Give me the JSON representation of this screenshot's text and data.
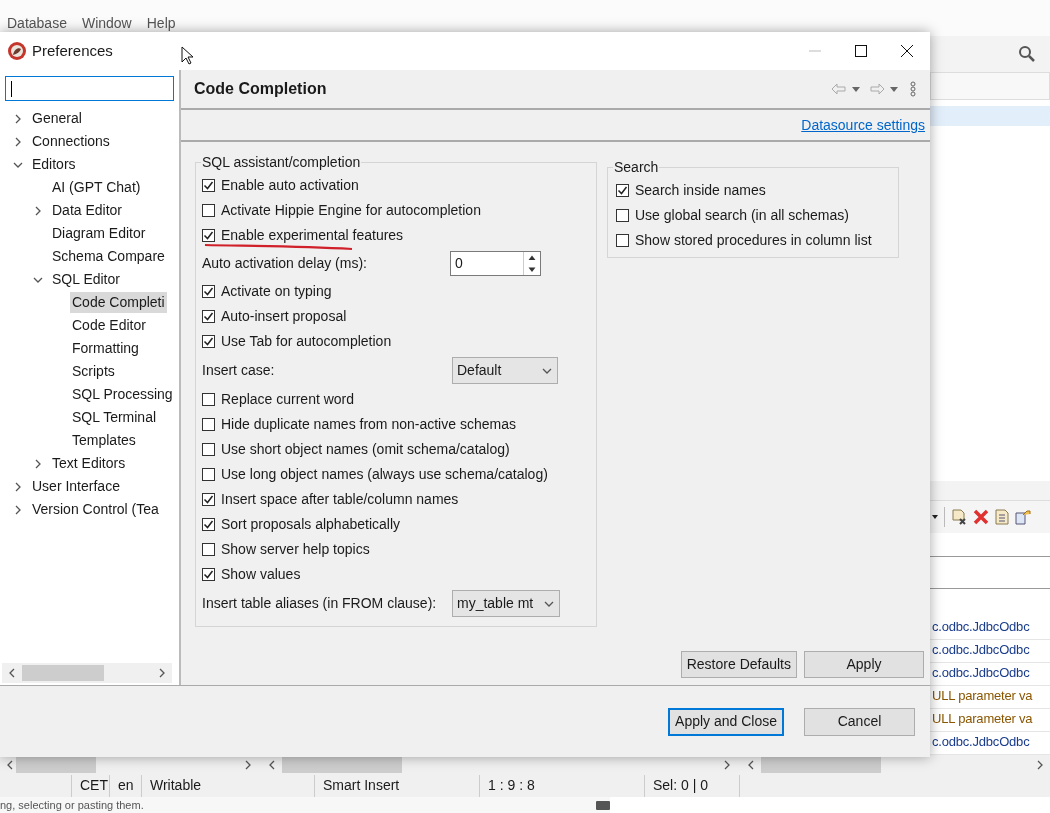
{
  "app": {
    "menu": [
      "Database",
      "Window",
      "Help"
    ],
    "log_rows": [
      {
        "text": "c.odbc.JdbcOdbc",
        "color": "#1a3c8c"
      },
      {
        "text": "c.odbc.JdbcOdbc",
        "color": "#1a3c8c"
      },
      {
        "text": "c.odbc.JdbcOdbc",
        "color": "#1a3c8c"
      },
      {
        "text": "ULL parameter va",
        "color": "#8a5600"
      },
      {
        "text": "ULL parameter va",
        "color": "#8a5600"
      },
      {
        "text": "c.odbc.JdbcOdbc",
        "color": "#1a3c8c"
      }
    ],
    "status_bar": [
      "CET",
      "en",
      "Writable",
      "Smart Insert",
      "1 : 9 : 8",
      "Sel: 0 | 0"
    ],
    "hint": "ng, selecting or pasting them."
  },
  "dialog": {
    "title": "Preferences",
    "tree": [
      {
        "label": "General",
        "kind": "folder",
        "expanded": false,
        "selected": false
      },
      {
        "label": "Connections",
        "kind": "folder",
        "expanded": false,
        "selected": false
      },
      {
        "label": "Editors",
        "kind": "folder",
        "expanded": true,
        "selected": false,
        "children": [
          {
            "label": "AI (GPT Chat)",
            "kind": "leaf",
            "selected": false
          },
          {
            "label": "Data Editor",
            "kind": "folder",
            "expanded": false,
            "selected": false
          },
          {
            "label": "Diagram Editor",
            "kind": "leaf",
            "selected": false
          },
          {
            "label": "Schema Compare",
            "kind": "leaf",
            "selected": false
          },
          {
            "label": "SQL Editor",
            "kind": "folder",
            "expanded": true,
            "selected": false,
            "children": [
              {
                "label": "Code Completi",
                "kind": "leaf",
                "selected": true
              },
              {
                "label": "Code Editor",
                "kind": "leaf",
                "selected": false
              },
              {
                "label": "Formatting",
                "kind": "leaf",
                "selected": false
              },
              {
                "label": "Scripts",
                "kind": "leaf",
                "selected": false
              },
              {
                "label": "SQL Processing",
                "kind": "leaf",
                "selected": false
              },
              {
                "label": "SQL Terminal",
                "kind": "leaf",
                "selected": false
              },
              {
                "label": "Templates",
                "kind": "leaf",
                "selected": false
              }
            ]
          },
          {
            "label": "Text Editors",
            "kind": "folder",
            "expanded": false,
            "selected": false
          }
        ]
      },
      {
        "label": "User Interface",
        "kind": "folder",
        "expanded": false,
        "selected": false
      },
      {
        "label": "Version Control (Tea",
        "kind": "folder",
        "expanded": false,
        "selected": false
      }
    ],
    "page": {
      "title": "Code Completion",
      "link": "Datasource settings",
      "main_group": {
        "title": "SQL assistant/completion",
        "rows": [
          {
            "kind": "checkbox",
            "label": "Enable auto activation",
            "checked": true,
            "marked": false
          },
          {
            "kind": "checkbox",
            "label": "Activate Hippie Engine for autocompletion",
            "checked": false,
            "marked": false
          },
          {
            "kind": "checkbox",
            "label": "Enable experimental features",
            "checked": true,
            "marked": true
          },
          {
            "kind": "spinner",
            "label": "Auto activation delay (ms):",
            "value": "0"
          },
          {
            "kind": "checkbox",
            "label": "Activate on typing",
            "checked": true,
            "marked": false
          },
          {
            "kind": "checkbox",
            "label": "Auto-insert proposal",
            "checked": true,
            "marked": false
          },
          {
            "kind": "checkbox",
            "label": "Use Tab for autocompletion",
            "checked": true,
            "marked": false
          },
          {
            "kind": "dropdown",
            "label": "Insert case:",
            "value": "Default"
          },
          {
            "kind": "checkbox",
            "label": "Replace current word",
            "checked": false,
            "marked": false
          },
          {
            "kind": "checkbox",
            "label": "Hide duplicate names from non-active schemas",
            "checked": false,
            "marked": false
          },
          {
            "kind": "checkbox",
            "label": "Use short object names (omit schema/catalog)",
            "checked": false,
            "marked": false
          },
          {
            "kind": "checkbox",
            "label": "Use long object names (always use schema/catalog)",
            "checked": false,
            "marked": false
          },
          {
            "kind": "checkbox",
            "label": "Insert space after table/column names",
            "checked": true,
            "marked": false
          },
          {
            "kind": "checkbox",
            "label": "Sort proposals alphabetically",
            "checked": true,
            "marked": false
          },
          {
            "kind": "checkbox",
            "label": "Show server help topics",
            "checked": false,
            "marked": false
          },
          {
            "kind": "checkbox",
            "label": "Show values",
            "checked": true,
            "marked": false
          },
          {
            "kind": "dropdown",
            "label": "Insert table aliases (in FROM clause):",
            "value": "my_table mt"
          }
        ]
      },
      "search_group": {
        "title": "Search",
        "rows": [
          {
            "kind": "checkbox",
            "label": "Search inside names",
            "checked": true,
            "marked": false
          },
          {
            "kind": "checkbox",
            "label": "Use global search (in all schemas)",
            "checked": false,
            "marked": false
          },
          {
            "kind": "checkbox",
            "label": "Show stored procedures in column list",
            "checked": false,
            "marked": false
          }
        ]
      },
      "buttons": [
        "Restore Defaults",
        "Apply"
      ]
    },
    "footer_buttons": [
      {
        "label": "Apply and Close",
        "default": true
      },
      {
        "label": "Cancel",
        "default": false
      }
    ]
  }
}
